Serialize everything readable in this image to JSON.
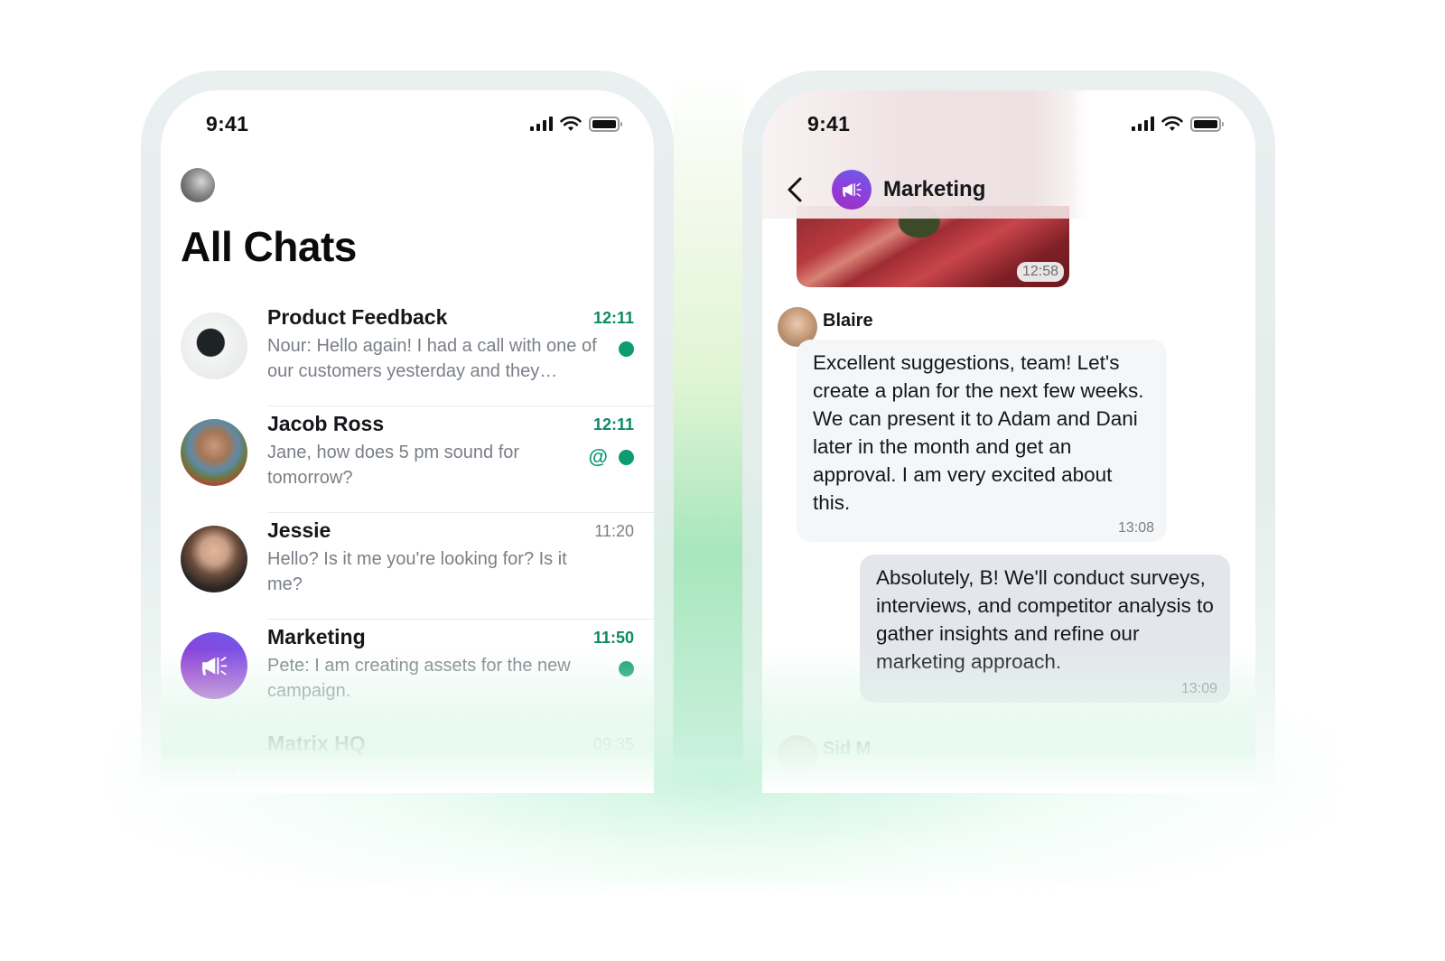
{
  "colors": {
    "accent_green": "#0d9b72",
    "unread_time": "#0b8a68",
    "marketing_gradient_start": "#6c5cf0",
    "marketing_gradient_end": "#a12cc6"
  },
  "left_phone": {
    "status_bar": {
      "time": "9:41",
      "icons": [
        "signal-icon",
        "wifi-icon",
        "battery-icon"
      ]
    },
    "user_avatar": "profile-avatar",
    "title": "All Chats",
    "chats": [
      {
        "name": "Product Feedback",
        "preview": "Nour: Hello again! I had a call with one of our customers yesterday and they…",
        "time": "12:11",
        "unread": true,
        "mention": false
      },
      {
        "name": "Jacob Ross",
        "preview": "Jane, how does 5 pm sound for tomorrow?",
        "time": "12:11",
        "unread": true,
        "mention": true,
        "mention_symbol": "@"
      },
      {
        "name": "Jessie",
        "preview": "Hello? Is it me you're looking for? Is it me?",
        "time": "11:20",
        "unread": false,
        "mention": false
      },
      {
        "name": "Marketing",
        "preview": "Pete: I am creating assets for the new campaign.",
        "time": "11:50",
        "unread": true,
        "mention": false
      },
      {
        "name": "Matrix HQ",
        "preview": "",
        "time": "09:35",
        "unread": false,
        "mention": false
      }
    ]
  },
  "right_phone": {
    "status_bar": {
      "time": "9:41",
      "icons": [
        "signal-icon",
        "wifi-icon",
        "battery-icon"
      ]
    },
    "header": {
      "back_icon": "chevron-left-icon",
      "room_name": "Marketing",
      "room_icon": "megaphone-icon"
    },
    "messages": [
      {
        "type": "image",
        "time": "12:58"
      },
      {
        "type": "text",
        "sender": "Blaire",
        "text": "Excellent suggestions, team! Let's create a plan for the next few weeks. We can present it to Adam and Dani later in the month and get an approval. I am very excited about this.",
        "time": "13:08",
        "direction": "incoming"
      },
      {
        "type": "text",
        "text": "Absolutely, B! We'll conduct surveys, interviews, and competitor analysis to gather insights and refine our marketing approach.",
        "time": "13:09",
        "direction": "outgoing"
      },
      {
        "type": "sender_only",
        "sender": "Sid M"
      }
    ]
  }
}
